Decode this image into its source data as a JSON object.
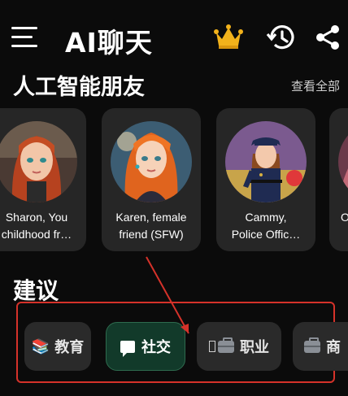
{
  "header": {
    "title": "AI聊天",
    "icons": [
      "menu-icon",
      "crown-icon",
      "history-icon",
      "share-icon"
    ],
    "accent_crown": "#f2b21b"
  },
  "friends": {
    "title": "人工智能朋友",
    "see_all": "查看全部",
    "cards": [
      {
        "name": "Sharon, You\nchildhood fr…",
        "avatar": "red-haired-girl-avatar"
      },
      {
        "name": "Karen, female\nfriend (SFW)",
        "avatar": "orange-haired-girl-avatar"
      },
      {
        "name": "Cammy,\nPolice Offic…",
        "avatar": "police-officer-avatar"
      },
      {
        "name": "O",
        "avatar": "partial-avatar"
      }
    ]
  },
  "suggestions": {
    "title": "建议",
    "pills": [
      {
        "label": "教育",
        "icon": "books-icon",
        "icon_glyph": "📚",
        "active": false
      },
      {
        "label": "社交",
        "icon": "chat-icon",
        "active": true
      },
      {
        "label": "职业",
        "icon": "briefcase-icon",
        "active": false
      },
      {
        "label": "商",
        "icon": "briefcase-icon",
        "active": false
      }
    ]
  },
  "colors": {
    "background": "#0b0b0b",
    "card": "#262626",
    "active_pill": "#123a2a",
    "annotation": "#d5322a"
  }
}
